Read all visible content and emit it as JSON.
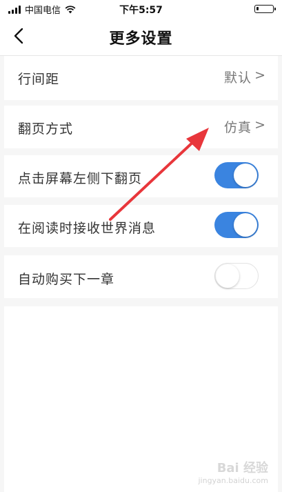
{
  "status_bar": {
    "carrier": "中国电信",
    "time": "下午5:57",
    "battery_level": 0.15
  },
  "nav": {
    "title": "更多设置",
    "back_icon": "chevron-left-icon"
  },
  "settings": {
    "line_spacing": {
      "label": "行间距",
      "value": "默认",
      "chevron": ">"
    },
    "page_turn": {
      "label": "翻页方式",
      "value": "仿真",
      "chevron": ">"
    },
    "tap_left_next": {
      "label": "点击屏幕左侧下翻页",
      "enabled": true
    },
    "world_messages": {
      "label": "在阅读时接收世界消息",
      "enabled": true
    },
    "auto_buy": {
      "label": "自动购买下一章",
      "enabled": false
    }
  },
  "annotation": {
    "type": "red-arrow",
    "color": "#e8363b"
  },
  "watermark": {
    "brand": "Bai 经验",
    "url": "jingyan.baidu.com"
  },
  "colors": {
    "toggle_on": "#3a84e0",
    "background": "#f6f6f6",
    "arrow": "#e8363b"
  }
}
